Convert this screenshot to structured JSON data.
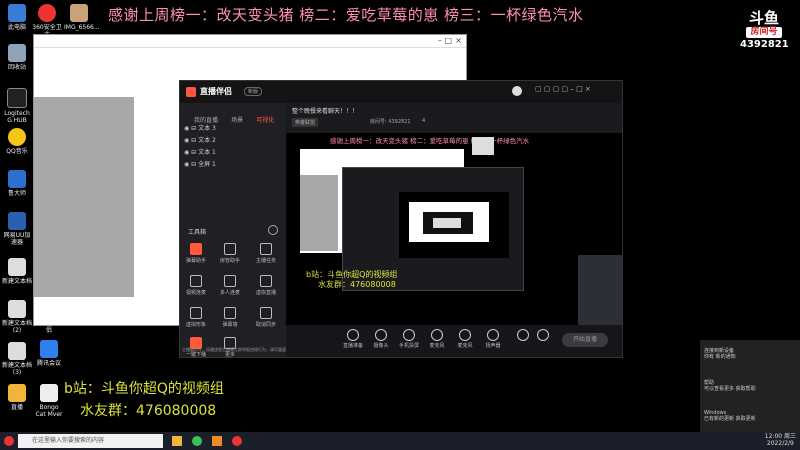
{
  "banner": "感谢上周榜一：改天变头猪 榜二：爱吃草莓的崽 榜三：一杯绿色汽水",
  "logo": {
    "mark": "斗鱼",
    "mark2": "房间号",
    "room_number": "4392821"
  },
  "desktop_icons": [
    "此电脑",
    "回收站",
    "Logitech G HUB",
    "QQ音乐",
    "鲁大师",
    "网易UU加速器",
    "新建文本档",
    "新建文本档 (2)",
    "新建文本档 (3)",
    "直播",
    "Bongo Cat Mver"
  ],
  "desktop_icons_b": [
    "360安全卫士",
    "IMG_6566...",
    "斗鱼直播伴侣",
    "腾讯会议"
  ],
  "bottom_text": {
    "line1": "b站：斗鱼你超Q的视频组",
    "line2": "水友群：476080008"
  },
  "app": {
    "brand": "直播伴侣",
    "badge": "新版",
    "tabs": [
      "我的直播",
      "场景",
      "可视化"
    ],
    "sources": [
      "文本 3",
      "文本 2",
      "文本 1",
      "全屏 1"
    ],
    "tools_label": "工具箱",
    "tools": [
      "弹幕助手",
      "房管助手",
      "主播任务",
      "视频连麦",
      "多人连麦",
      "虚拟直播",
      "虚拟形象",
      "弹幕墙",
      "取消同步",
      "一键下播",
      "更多"
    ],
    "stream_title": "整个晚餐来看聊天！！！",
    "room_label": "房间号: 4392821",
    "category": "英雄联盟",
    "viewers": "4",
    "notice": "主播被封号，如遇违规主播请立即举报违规行为，请尽量遵守平台直播规范",
    "controls": [
      "直播准备",
      "摄像头",
      "手机投屏",
      "麦克风",
      "麦克风",
      "扬声器",
      "",
      ""
    ],
    "start_button": "开始直播"
  },
  "nested_banner": "感谢上周榜一：改天变头猪 榜二：爱吃草莓的崽 榜三：一杯绿色汽水",
  "nested_bottom": {
    "line1": "b站：斗鱼你超Q的视频组",
    "line2": "水友群：476080008"
  },
  "taskbar": {
    "search_placeholder": "在这里输入你要搜索的内容",
    "time": "12:00 周三",
    "date": "2022/2/9"
  },
  "notifications": [
    {
      "title": "连接到新设备",
      "body": "你有 新的通知"
    },
    {
      "title": "帮助",
      "body": "可以查看更多 获取帮助"
    },
    {
      "title": "Windows",
      "body": "已有新的更新 获取更新"
    }
  ],
  "colors": {
    "banner": "#ff8fb2",
    "bottom": "#dde23a",
    "accent": "#ff5a3c"
  }
}
